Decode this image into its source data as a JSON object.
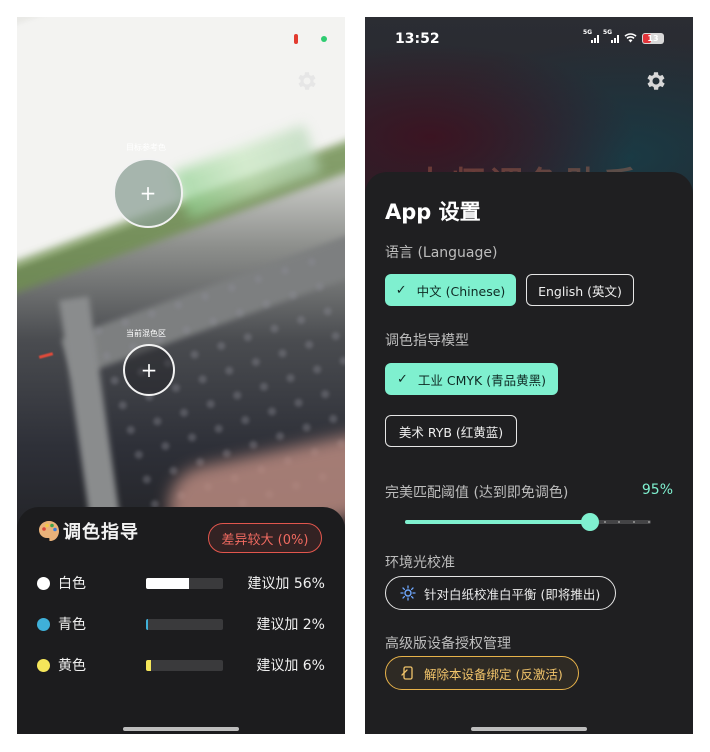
{
  "left_screen": {
    "reference_label": "目标参考色",
    "mix_label": "当前混色区",
    "add_symbol": "+",
    "guide": {
      "title": "调色指导",
      "status_badge": "差异较大 (0%)",
      "rows": [
        {
          "name": "白色",
          "dot_color": "#ffffff",
          "bar_color": "#ffffff",
          "fraction": 0.56,
          "suggestion": "建议加 56%"
        },
        {
          "name": "青色",
          "dot_color": "#3fb0d8",
          "bar_color": "#3fb0d8",
          "fraction": 0.02,
          "suggestion": "建议加 2%"
        },
        {
          "name": "黄色",
          "dot_color": "#f5e65a",
          "bar_color": "#f5e65a",
          "fraction": 0.06,
          "suggestion": "建议加 6%"
        }
      ]
    }
  },
  "right_screen": {
    "status_bar": {
      "time": "13:52",
      "net1": "5G",
      "net2": "5G",
      "battery": "13"
    },
    "hero_title": "大师调色助手",
    "settings": {
      "title": "App 设置",
      "language_label": "语言 (Language)",
      "language_options": [
        "中文 (Chinese)",
        "English (英文)"
      ],
      "language_selected": 0,
      "model_label": "调色指导模型",
      "model_options": [
        "工业 CMYK (青品黄黑)",
        "美术 RYB (红黄蓝)"
      ],
      "model_selected": 0,
      "threshold_label": "完美匹配阈值 (达到即免调色)",
      "threshold_value_text": "95%",
      "threshold_fraction": 0.75,
      "ambient_label": "环境光校准",
      "ambient_button": "针对白纸校准白平衡 (即将推出)",
      "license_label": "高级版设备授权管理",
      "license_button": "解除本设备绑定 (反激活)"
    },
    "accent_color": "#7ff0cf",
    "warning_color": "#e7b24a",
    "icons": [
      "settings-gear",
      "check",
      "sun",
      "unlink"
    ]
  }
}
